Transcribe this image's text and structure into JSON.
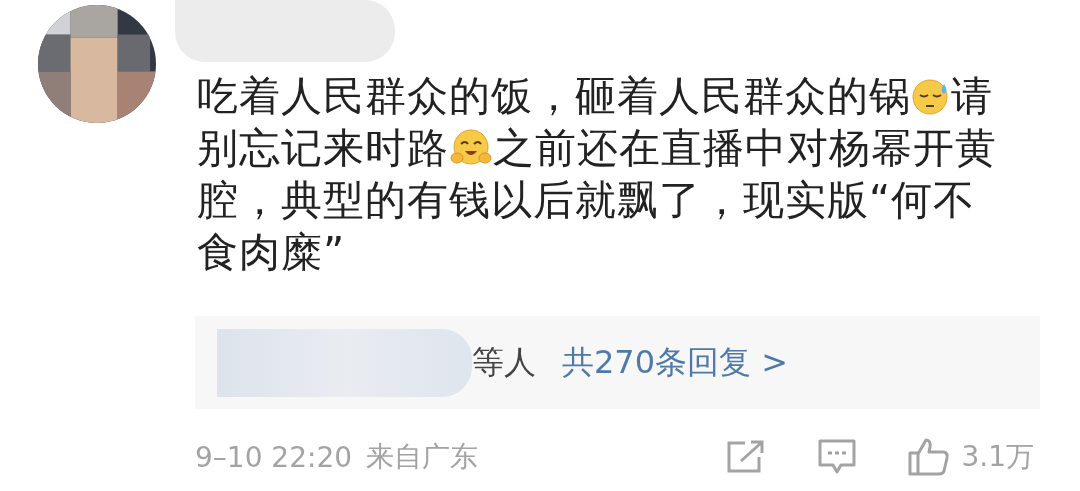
{
  "comment": {
    "parts": [
      {
        "kind": "text",
        "text": "吃着人民群众的饭，砸着人民群众的锅"
      },
      {
        "kind": "sweat"
      },
      {
        "kind": "text",
        "text": "请别忘记来时路"
      },
      {
        "kind": "hug"
      },
      {
        "kind": "text",
        "text": "之前还在直播中对杨幂开黄腔，典型的有钱以后就飘了，现实版“何不食肉糜”"
      }
    ]
  },
  "replies": {
    "names_suffix": "等人",
    "link": "共270条回复 >"
  },
  "footer": {
    "time": "9–10 22:20",
    "source": "来自广东",
    "likes": "3.1万"
  }
}
